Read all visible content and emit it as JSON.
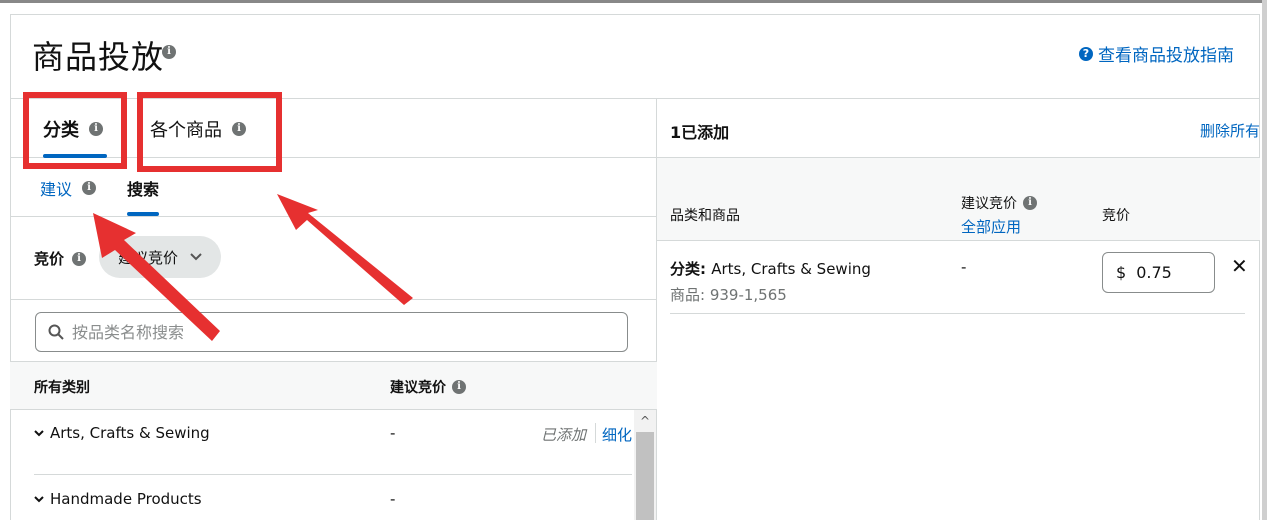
{
  "header": {
    "title": "商品投放",
    "guide_link": "查看商品投放指南"
  },
  "tabs": {
    "category": "分类",
    "product": "各个商品"
  },
  "subtabs": {
    "suggested": "建议",
    "search": "搜索"
  },
  "bid": {
    "label": "竞价",
    "dropdown_value": "建议竞价"
  },
  "search": {
    "placeholder": "按品类名称搜索"
  },
  "table": {
    "col_all": "所有类别",
    "col_suggested_bid": "建议竞价",
    "rows": [
      {
        "name": "Arts, Crafts & Sewing",
        "bid": "-",
        "status": "已添加",
        "action": "细化"
      },
      {
        "name": "Handmade Products",
        "bid": "-"
      }
    ]
  },
  "added": {
    "count_label": "1已添加",
    "remove_all": "删除所有",
    "col_name": "品类和商品",
    "col_suggested": "建议竞价",
    "apply_all": "全部应用",
    "col_bid": "竞价",
    "items": [
      {
        "category_prefix": "分类: ",
        "category": "Arts, Crafts & Sewing",
        "count": "商品: 939-1,565",
        "suggested": "-",
        "currency": "$",
        "bid": "0.75"
      }
    ]
  },
  "annotations": {
    "color": "#e63030"
  }
}
